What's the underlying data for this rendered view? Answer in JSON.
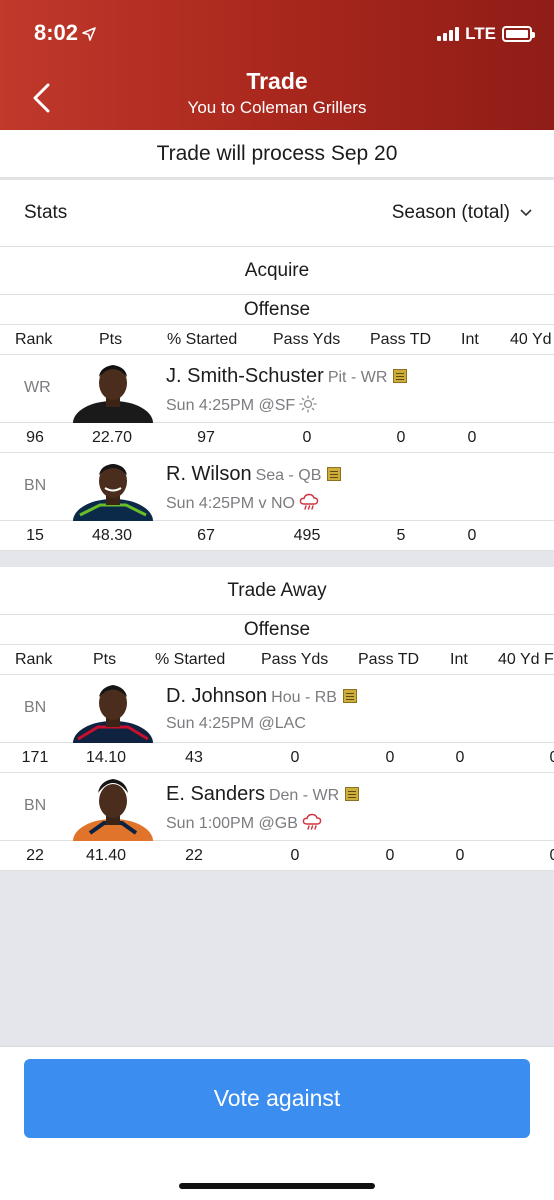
{
  "status_bar": {
    "time": "8:02",
    "network": "LTE"
  },
  "header": {
    "title": "Trade",
    "subtitle": "You to Coleman Grillers"
  },
  "process_text": "Trade will process Sep 20",
  "stats": {
    "label": "Stats",
    "selected": "Season (total)"
  },
  "columns": [
    "Rank",
    "Pts",
    "% Started",
    "Pass Yds",
    "Pass TD",
    "Int",
    "40 Yd"
  ],
  "acquire": {
    "title": "Acquire",
    "group": "Offense",
    "players": [
      {
        "pos": "WR",
        "name": "J. Smith-Schuster",
        "team": "Pit - WR",
        "game": "Sun 4:25PM @SF",
        "weather_icon": "sun-icon",
        "stats": [
          "96",
          "22.70",
          "97",
          "0",
          "0",
          "0"
        ],
        "jersey_color": "#1a1a1a"
      },
      {
        "pos": "BN",
        "name": "R. Wilson",
        "team": "Sea - QB",
        "game": "Sun 4:25PM v NO",
        "weather_icon": "rain-cloud-icon",
        "stats": [
          "15",
          "48.30",
          "67",
          "495",
          "5",
          "0"
        ],
        "jersey_color": "#0b2a4a"
      }
    ]
  },
  "trade_away": {
    "title": "Trade Away",
    "group": "Offense",
    "players": [
      {
        "pos": "BN",
        "name": "D. Johnson",
        "team": "Hou - RB",
        "game": "Sun 4:25PM @LAC",
        "weather_icon": "",
        "stats": [
          "171",
          "14.10",
          "43",
          "0",
          "0",
          "0",
          "0"
        ],
        "jersey_color": "#0f2240"
      },
      {
        "pos": "BN",
        "name": "E. Sanders",
        "team": "Den - WR",
        "game": "Sun 1:00PM @GB",
        "weather_icon": "rain-cloud-icon",
        "stats": [
          "22",
          "41.40",
          "22",
          "0",
          "0",
          "0",
          "0"
        ],
        "jersey_color": "#e0742a"
      }
    ]
  },
  "vote_button": "Vote against",
  "colors": {
    "header_start": "#c0392b",
    "header_end": "#8f1d17",
    "button": "#3b8ef0"
  }
}
